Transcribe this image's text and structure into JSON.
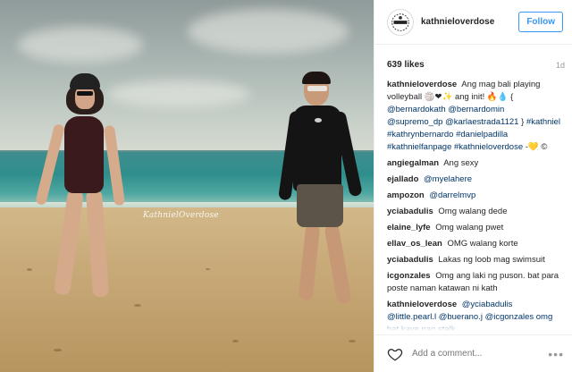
{
  "photo": {
    "watermark": "KathnielOverdose"
  },
  "header": {
    "username": "kathnieloverdose",
    "follow_label": "Follow"
  },
  "meta": {
    "likes": "639 likes",
    "age": "1d"
  },
  "caption": {
    "author": "kathnieloverdose",
    "text_1": "Ang mag bali playing volleyball 🏐❤✨ ang init! 🔥💧 {",
    "tags_1": "@bernardokath @bernardomin @supremo_dp @karlaestrada1121",
    "text_2": "}",
    "hashtags": "#kathniel #kathrynbernardo #danielpadilla #kathnielfanpage #kathnieloverdose",
    "text_3": "-💛 ©"
  },
  "comments": [
    {
      "author": "angiegalman",
      "text": "Ang sexy"
    },
    {
      "author": "ejallado",
      "text": "@myelahere"
    },
    {
      "author": "ampozon",
      "text": "@darrelmvp"
    },
    {
      "author": "yciabadulis",
      "text": "Omg walang dede"
    },
    {
      "author": "elaine_lyfe",
      "text": "Omg walang pwet"
    },
    {
      "author": "ellav_os_lean",
      "text": "OMG walang korte"
    },
    {
      "author": "yciabadulis",
      "text": "Lakas ng loob mag swimsuit"
    },
    {
      "author": "icgonzales",
      "text": "Omg ang laki ng puson. bat para poste naman katawan ni kath"
    },
    {
      "author": "kathnieloverdose",
      "text": "@yciabadulis @little.pearl.l @buerano.j @icgonzales omg hat kaye nao stalk"
    }
  ],
  "footer": {
    "placeholder": "Add a comment...",
    "more_icon": "•••"
  },
  "colors": {
    "accent": "#3897f0",
    "tag": "#003569"
  }
}
